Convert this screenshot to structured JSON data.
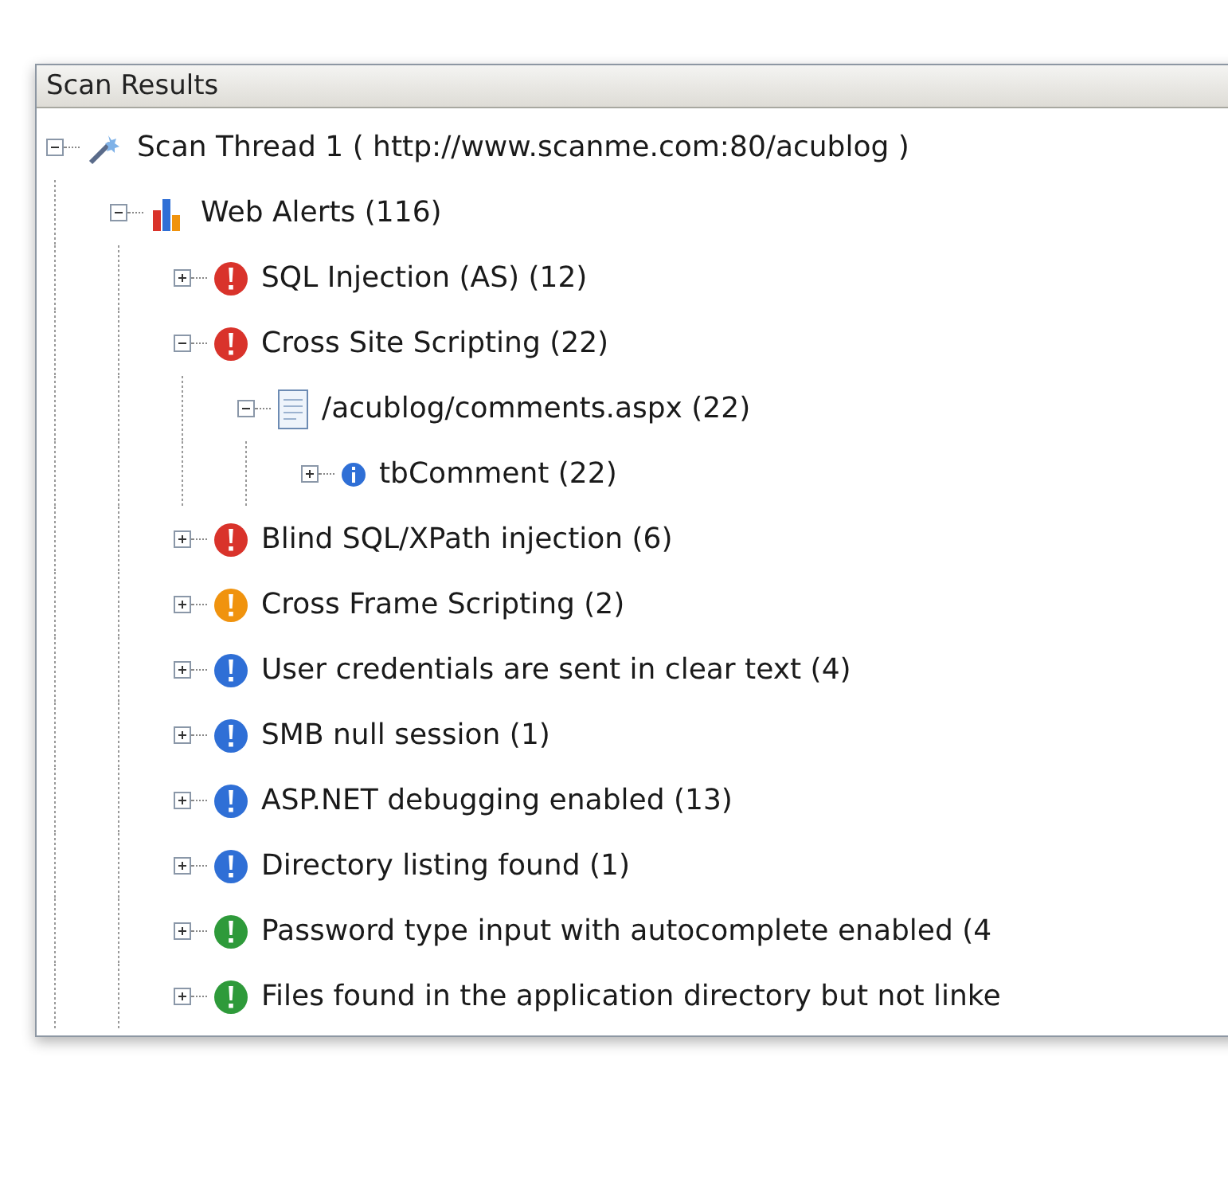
{
  "panel": {
    "title": "Scan Results"
  },
  "tree": [
    {
      "kind": "thread",
      "label": "Scan Thread 1 ( http://www.scanme.com:80/acublog )",
      "expanded": true,
      "children": [
        {
          "kind": "alerts",
          "label": "Web Alerts (116)",
          "expanded": true,
          "children": [
            {
              "kind": "alert",
              "color": "#d9332b",
              "label": "SQL Injection (AS) (12)",
              "expanded": false
            },
            {
              "kind": "alert",
              "color": "#d9332b",
              "label": "Cross Site Scripting (22)",
              "expanded": true,
              "children": [
                {
                  "kind": "file",
                  "label": "/acublog/comments.aspx (22)",
                  "expanded": true,
                  "children": [
                    {
                      "kind": "info",
                      "label": "tbComment (22)",
                      "expanded": false
                    }
                  ]
                }
              ]
            },
            {
              "kind": "alert",
              "color": "#d9332b",
              "label": "Blind SQL/XPath injection (6)",
              "expanded": false
            },
            {
              "kind": "alert",
              "color": "#f0930e",
              "label": "Cross Frame Scripting (2)",
              "expanded": false
            },
            {
              "kind": "alert",
              "color": "#2f6fd6",
              "label": "User credentials are sent in clear text (4)",
              "expanded": false
            },
            {
              "kind": "alert",
              "color": "#2f6fd6",
              "label": "SMB null session (1)",
              "expanded": false
            },
            {
              "kind": "alert",
              "color": "#2f6fd6",
              "label": "ASP.NET debugging enabled (13)",
              "expanded": false
            },
            {
              "kind": "alert",
              "color": "#2f6fd6",
              "label": "Directory listing found (1)",
              "expanded": false
            },
            {
              "kind": "alert",
              "color": "#2e9a3a",
              "label": "Password type input with autocomplete enabled (4",
              "expanded": false
            },
            {
              "kind": "alert",
              "color": "#2e9a3a",
              "label": "Files found in the application directory but not linke",
              "expanded": false
            }
          ]
        }
      ]
    }
  ]
}
